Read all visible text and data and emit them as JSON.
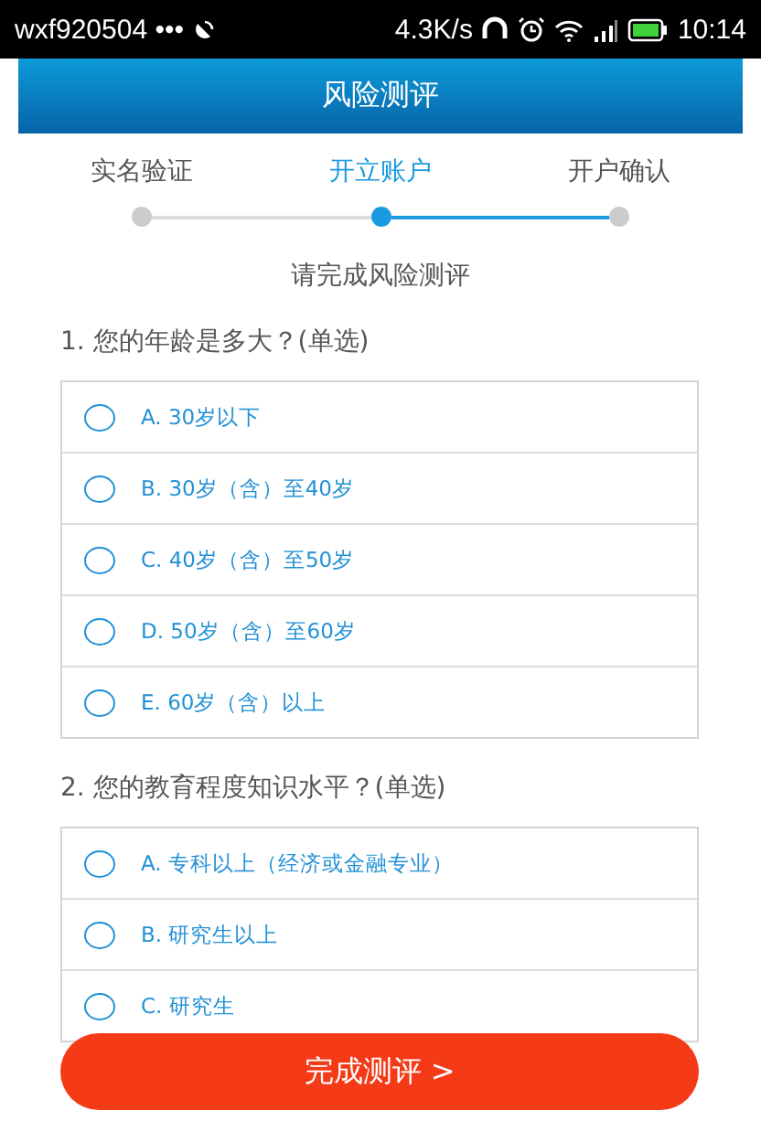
{
  "status_bar": {
    "carrier": "wxf920504 •••",
    "speed": "4.3K/s",
    "time": "10:14"
  },
  "header": {
    "title": "风险测评"
  },
  "steps": [
    {
      "label": "实名验证",
      "selected": false
    },
    {
      "label": "开立账户",
      "selected": true
    },
    {
      "label": "开户确认",
      "selected": false
    }
  ],
  "subtitle": "请完成风险测评",
  "questions": [
    {
      "title": "1. 您的年龄是多大？(单选)",
      "options": [
        {
          "label": "A. 30岁以下",
          "selected": false
        },
        {
          "label": "B. 30岁（含）至40岁",
          "selected": false
        },
        {
          "label": "C. 40岁（含）至50岁",
          "selected": false
        },
        {
          "label": "D. 50岁（含）至60岁",
          "selected": false
        },
        {
          "label": "E. 60岁（含）以上",
          "selected": false
        }
      ]
    },
    {
      "title": "2. 您的教育程度知识水平？(单选)",
      "options": [
        {
          "label": "A. 专科以上（经济或金融专业）",
          "selected": false
        },
        {
          "label": "B. 研究生以上",
          "selected": false
        },
        {
          "label": "C. 研究生",
          "selected": false
        }
      ]
    }
  ],
  "submit_button": "完成测评 >"
}
